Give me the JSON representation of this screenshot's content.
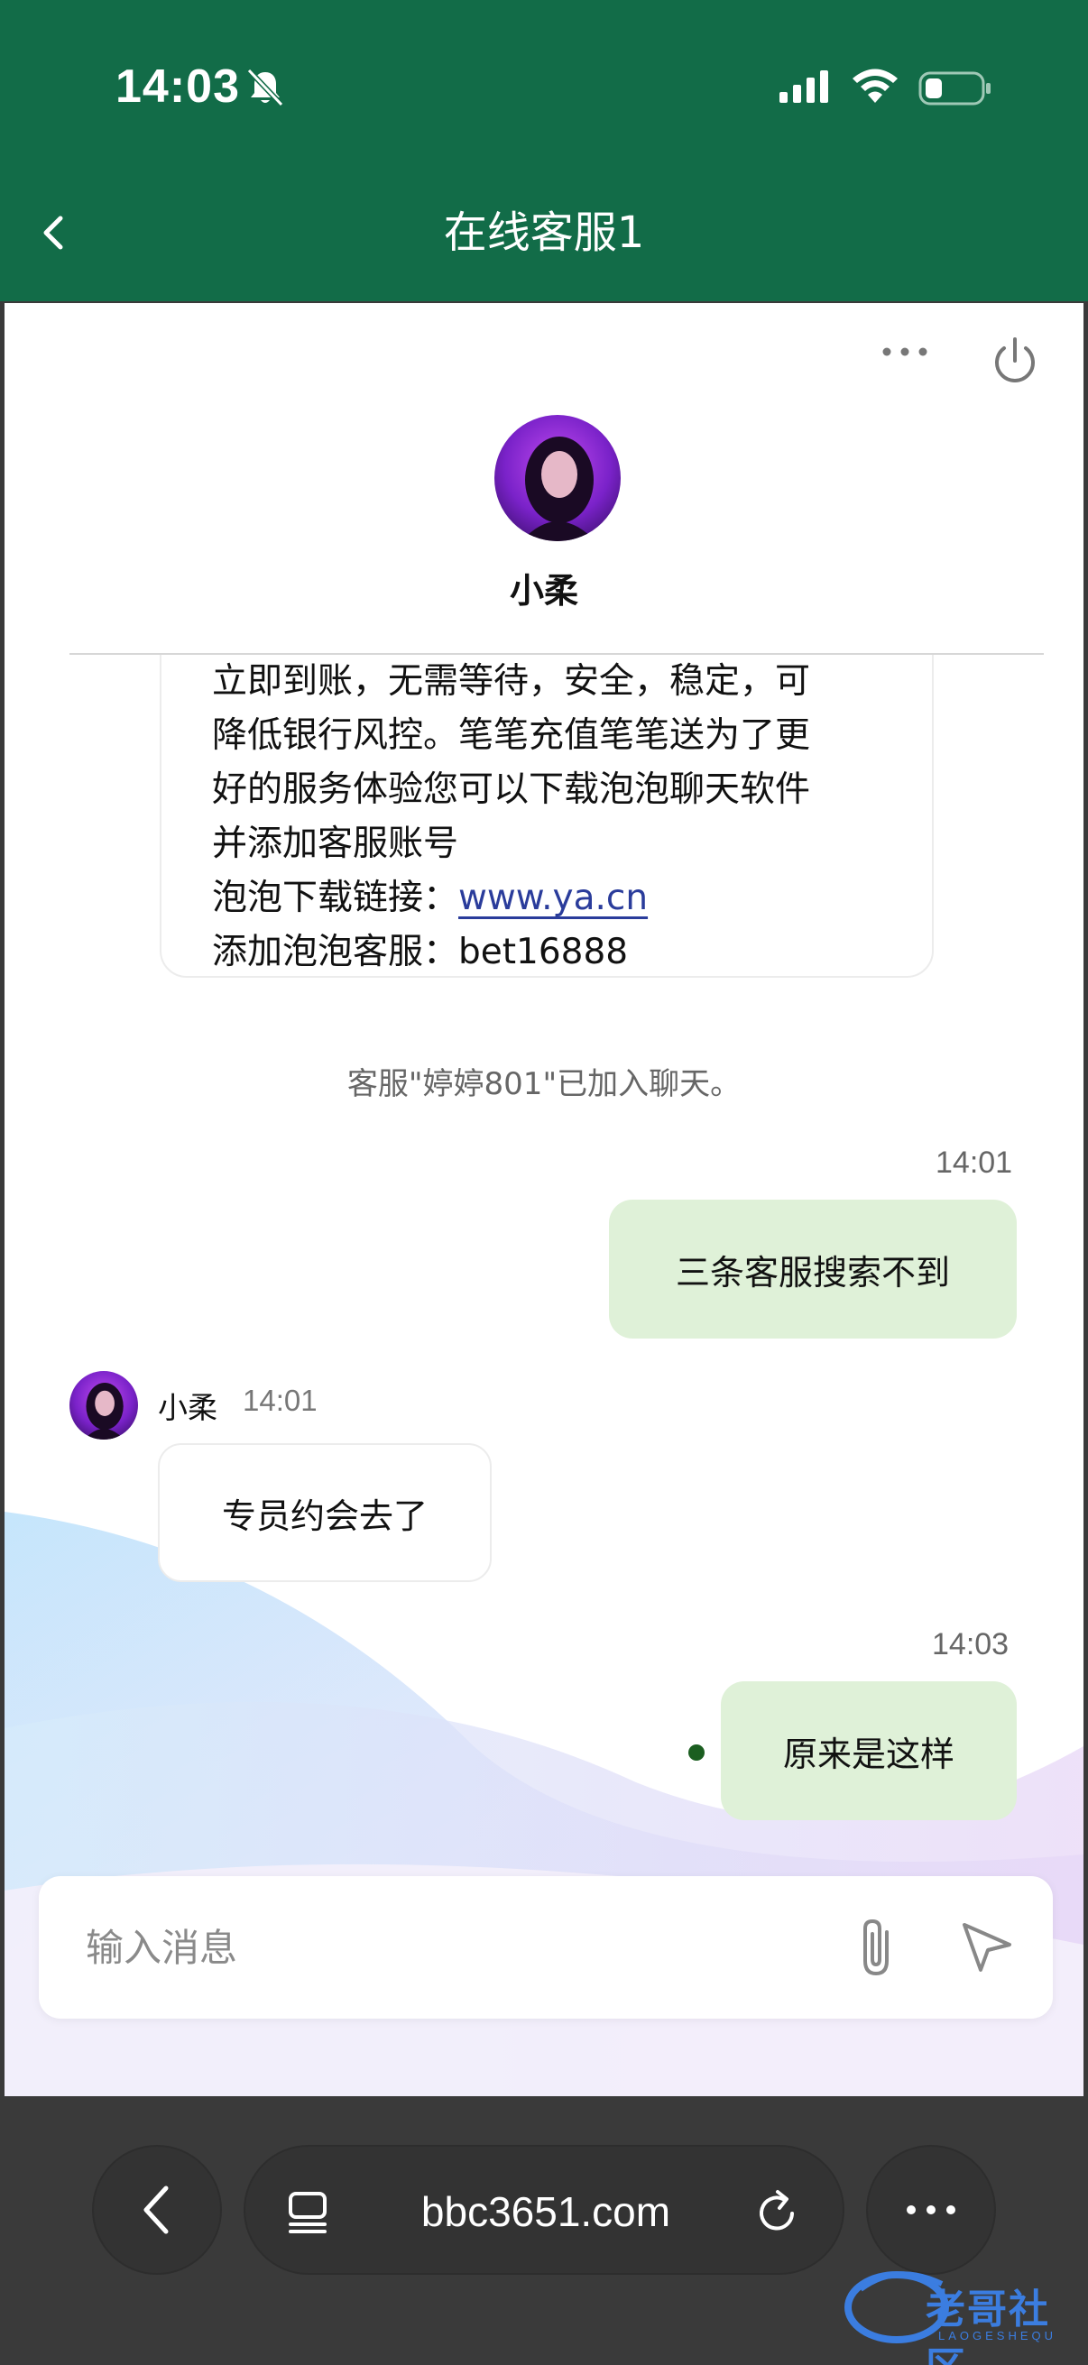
{
  "status_bar": {
    "time": "14:03"
  },
  "nav": {
    "title": "在线客服1"
  },
  "agent": {
    "name": "小柔"
  },
  "card": {
    "lines": [
      "立即到账，无需等待，安全，稳定，可",
      "降低银行风控。笔笔充值笔笔送为了更",
      "好的服务体验您可以下载泡泡聊天软件",
      "并添加客服账号"
    ],
    "download_label": "泡泡下载链接：",
    "download_link": "www.ya.cn",
    "add_label": "添加泡泡客服：",
    "add_value": "bet16888"
  },
  "system_message": "客服\"婷婷801\"已加入聊天。",
  "messages": [
    {
      "time": "14:01",
      "text": "三条客服搜索不到"
    },
    {
      "sender": "小柔",
      "time": "14:01",
      "text": "专员约会去了"
    },
    {
      "time": "14:03",
      "text": "原来是这样"
    }
  ],
  "input": {
    "placeholder": "输入消息"
  },
  "browser": {
    "url": "bbc3651.com"
  },
  "watermark": {
    "text": "老哥社区",
    "sub": "LAOGESHEQU"
  },
  "colors": {
    "header_green": "#126c48",
    "bubble_out": "#dff1d8",
    "link_blue": "#2a3c9b"
  }
}
